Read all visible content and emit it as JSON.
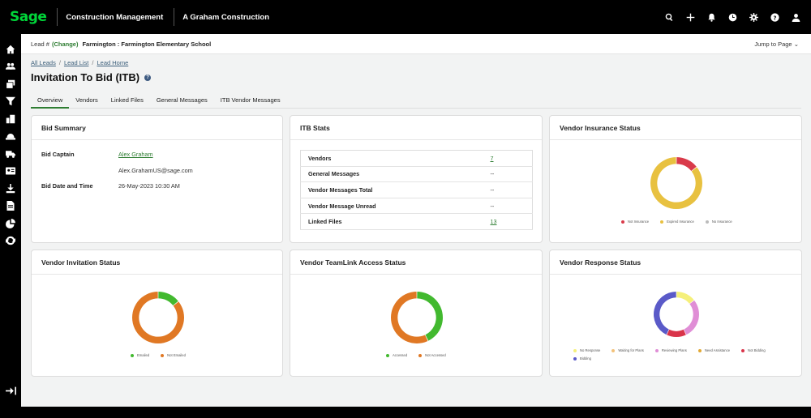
{
  "topbar": {
    "logo": "Sage",
    "product": "Construction Management",
    "company": "A Graham Construction",
    "icons": [
      "search-icon",
      "plus-icon",
      "bell-icon",
      "clock-icon",
      "gear-icon",
      "help-icon",
      "user-icon"
    ]
  },
  "sidebar": {
    "items": [
      "home-icon",
      "people-icon",
      "layers-icon",
      "filter-icon",
      "building-icon",
      "hardhat-icon",
      "truck-icon",
      "id-card-icon",
      "download-icon",
      "document-icon",
      "pie-chart-icon",
      "refresh-icon"
    ],
    "collapse": "collapse-sidebar-icon"
  },
  "leadbar": {
    "label": "Lead #",
    "change": "(Change)",
    "name": "Farmington : Farmington Elementary School",
    "jump": "Jump to Page"
  },
  "breadcrumb": [
    "All Leads",
    "Lead List",
    "Lead Home"
  ],
  "page_title": "Invitation To Bid (ITB)",
  "tabs": [
    "Overview",
    "Vendors",
    "Linked Files",
    "General Messages",
    "ITB Vendor Messages"
  ],
  "bid_summary": {
    "title": "Bid Summary",
    "captain_label": "Bid Captain",
    "captain_name": "Alex Graham",
    "captain_email": "Alex.GrahamUS@sage.com",
    "date_label": "Bid Date and Time",
    "date_value": "26-May-2023   10:30 AM"
  },
  "itb_stats": {
    "title": "ITB Stats",
    "rows": [
      {
        "k": "Vendors",
        "v": "7",
        "link": true
      },
      {
        "k": "General Messages",
        "v": "--",
        "link": false
      },
      {
        "k": "Vendor Messages Total",
        "v": "--",
        "link": false
      },
      {
        "k": "Vendor Message Unread",
        "v": "--",
        "link": false
      },
      {
        "k": "Linked Files",
        "v": "13",
        "link": true
      }
    ]
  },
  "colors": {
    "accent": "#2e7d32",
    "not_insurance": "#d93a4a",
    "expired_insurance": "#e8c140",
    "no_insurance": "#bbbbbb",
    "emailed": "#42b92f",
    "not_emailed": "#e07824",
    "no_response": "#f5f07a",
    "waiting_for_plans": "#f3c27a",
    "reviewing_plans": "#e08ed6",
    "need_assistance": "#e2a935",
    "not_bidding": "#d9344a",
    "bidding": "#5a5ac8"
  },
  "charts": [
    {
      "id": "insurance",
      "title": "Vendor Insurance Status",
      "segments": [
        {
          "name": "Not Insurance",
          "value": 1,
          "color": "#d93a4a"
        },
        {
          "name": "Expired Insurance",
          "value": 6,
          "color": "#e8c140"
        },
        {
          "name": "No Insurance",
          "value": 0,
          "color": "#bbbbbb"
        }
      ]
    },
    {
      "id": "invitation",
      "title": "Vendor Invitation Status",
      "segments": [
        {
          "name": "Emailed",
          "value": 1,
          "color": "#42b92f"
        },
        {
          "name": "Not Emailed",
          "value": 6,
          "color": "#e07824"
        }
      ]
    },
    {
      "id": "teamlink",
      "title": "Vendor TeamLink Access Status",
      "segments": [
        {
          "name": "Accessed",
          "value": 3,
          "color": "#42b92f"
        },
        {
          "name": "Not Accessed",
          "value": 4,
          "color": "#e07824"
        }
      ]
    },
    {
      "id": "response",
      "title": "Vendor Response Status",
      "segments": [
        {
          "name": "No Response",
          "value": 1,
          "color": "#f5f07a"
        },
        {
          "name": "Waiting for Plans",
          "value": 0,
          "color": "#f3c27a"
        },
        {
          "name": "Reviewing Plans",
          "value": 2,
          "color": "#e08ed6"
        },
        {
          "name": "Need Assistance",
          "value": 0,
          "color": "#e2a935"
        },
        {
          "name": "Not Bidding",
          "value": 1,
          "color": "#d9344a"
        },
        {
          "name": "Bidding",
          "value": 3,
          "color": "#5a5ac8"
        }
      ]
    }
  ]
}
